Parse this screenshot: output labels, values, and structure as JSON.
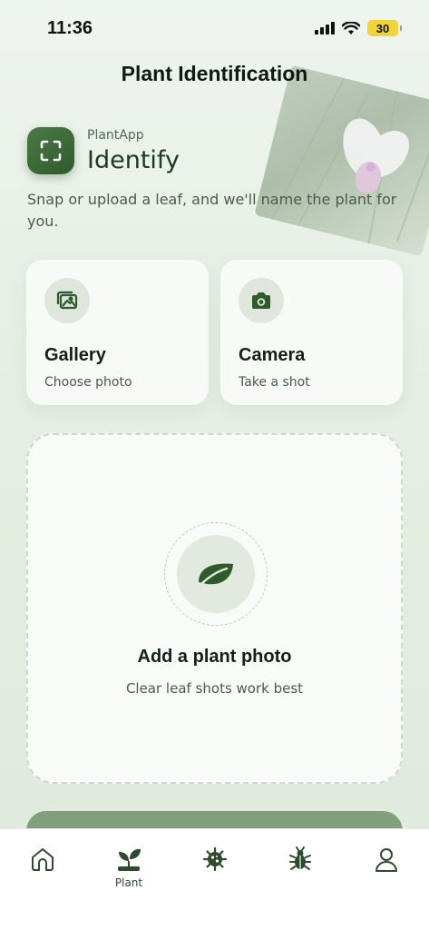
{
  "status": {
    "time": "11:36",
    "battery": "30"
  },
  "header": {
    "title": "Plant Identification"
  },
  "brand": {
    "name": "PlantApp",
    "heading": "Identify",
    "icon": "scan-icon"
  },
  "subtitle": "Snap or upload a leaf, and we'll name the plant for you.",
  "options": [
    {
      "title": "Gallery",
      "subtitle": "Choose photo",
      "icon": "gallery-icon"
    },
    {
      "title": "Camera",
      "subtitle": "Take a shot",
      "icon": "camera-icon"
    }
  ],
  "upload": {
    "title": "Add a plant photo",
    "hint": "Clear leaf shots work best",
    "icon": "leaf-icon"
  },
  "tabbar": {
    "items": [
      {
        "icon": "home-icon",
        "label": ""
      },
      {
        "icon": "plant-icon",
        "label": "Plant"
      },
      {
        "icon": "virus-icon",
        "label": ""
      },
      {
        "icon": "bug-icon",
        "label": ""
      },
      {
        "icon": "profile-icon",
        "label": ""
      }
    ]
  },
  "colors": {
    "primary": "#2f5a2c",
    "accent_light": "#dfe7dc",
    "background": "#e4eee2"
  }
}
